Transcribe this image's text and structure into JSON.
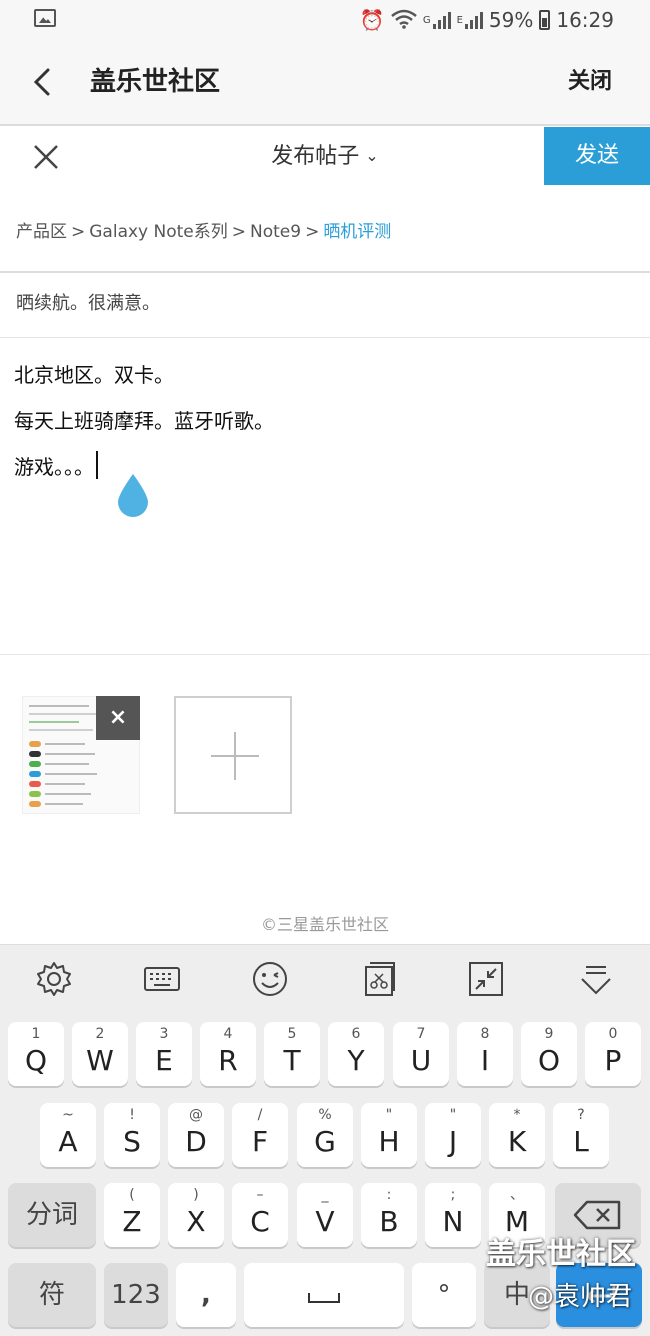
{
  "status_bar": {
    "network_1": "G",
    "network_2": "E",
    "battery": "59%",
    "time": "16:29"
  },
  "header": {
    "title": "盖乐世社区",
    "close_label": "关闭"
  },
  "compose": {
    "title": "发布帖子",
    "send_label": "发送"
  },
  "breadcrumb": {
    "items": [
      "产品区",
      "Galaxy Note系列",
      "Note9"
    ],
    "separator": ">",
    "active": "晒机评测"
  },
  "post": {
    "title": "晒续航。很满意。",
    "body_lines": [
      "北京地区。双卡。",
      "每天上班骑摩拜。蓝牙听歌。",
      "游戏。。。"
    ]
  },
  "footer": {
    "copyright": "©三星盖乐世社区"
  },
  "attachments": {
    "remove_glyph": "×"
  },
  "keyboard": {
    "tools": [
      "gear-icon",
      "keyboard-icon",
      "emoji-icon",
      "clipboard-icon",
      "resize-icon",
      "hide-keyboard-icon"
    ],
    "row1": [
      {
        "num": "1",
        "key": "Q"
      },
      {
        "num": "2",
        "key": "W"
      },
      {
        "num": "3",
        "key": "E"
      },
      {
        "num": "4",
        "key": "R"
      },
      {
        "num": "5",
        "key": "T"
      },
      {
        "num": "6",
        "key": "Y"
      },
      {
        "num": "7",
        "key": "U"
      },
      {
        "num": "8",
        "key": "I"
      },
      {
        "num": "9",
        "key": "O"
      },
      {
        "num": "0",
        "key": "P"
      }
    ],
    "row2": [
      {
        "num": "~",
        "key": "A"
      },
      {
        "num": "!",
        "key": "S"
      },
      {
        "num": "@",
        "key": "D"
      },
      {
        "num": "/",
        "key": "F"
      },
      {
        "num": "%",
        "key": "G"
      },
      {
        "num": "\"",
        "key": "H"
      },
      {
        "num": "\"",
        "key": "J"
      },
      {
        "num": "*",
        "key": "K"
      },
      {
        "num": "?",
        "key": "L"
      }
    ],
    "row3": [
      {
        "num": "(",
        "key": "Z"
      },
      {
        "num": ")",
        "key": "X"
      },
      {
        "num": "–",
        "key": "C"
      },
      {
        "num": "_",
        "key": "V"
      },
      {
        "num": ":",
        "key": "B"
      },
      {
        "num": ";",
        "key": "N"
      },
      {
        "num": "、",
        "key": "M"
      }
    ],
    "split_word": "分词",
    "symbol": "符",
    "numbers": "123",
    "comma": ",",
    "period": "°",
    "lang": "中"
  },
  "watermark": {
    "line1": "盖乐世社区",
    "line2": "@袁帅君"
  }
}
